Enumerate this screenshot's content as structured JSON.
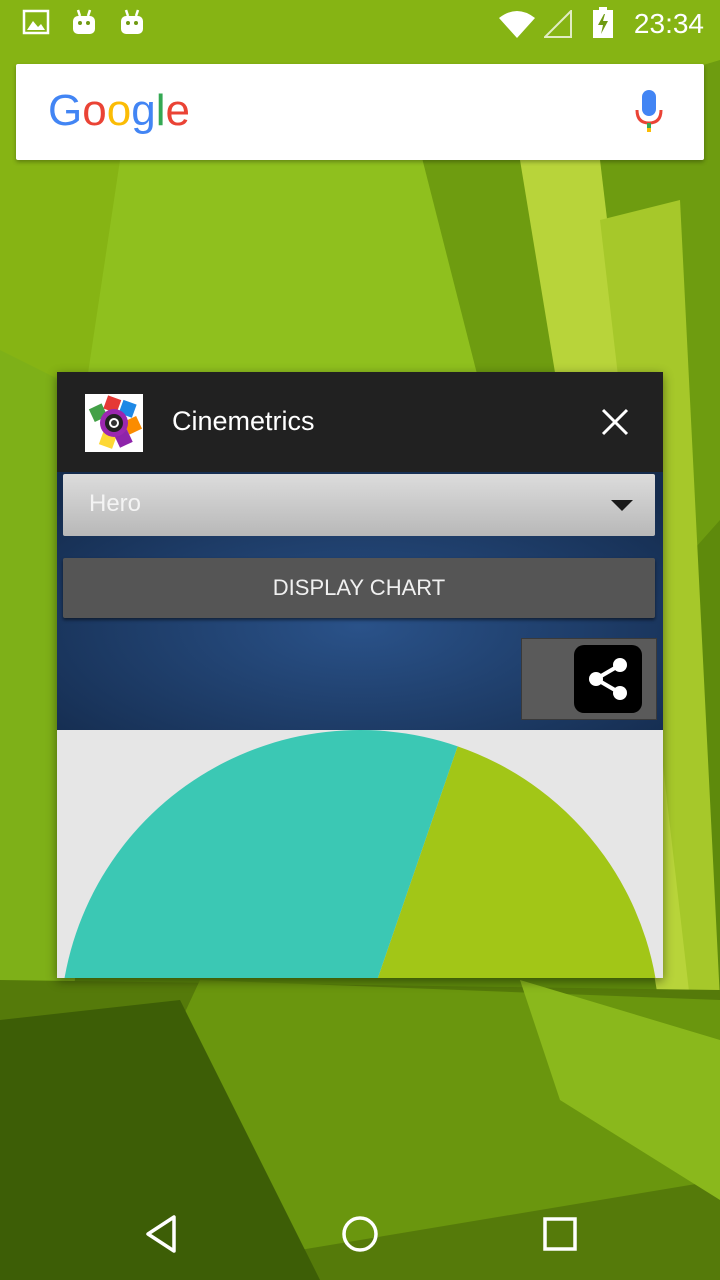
{
  "status_bar": {
    "time": "23:34",
    "icons": [
      "image-notification-icon",
      "android-notification-icon",
      "android-notification-icon",
      "wifi-icon",
      "signal-icon",
      "battery-charging-icon"
    ]
  },
  "search": {
    "logo_text": "Google",
    "logo_colors": [
      "#4285F4",
      "#EA4335",
      "#FBBC05",
      "#4285F4",
      "#34A853",
      "#EA4335"
    ],
    "mic_icon": "mic-icon"
  },
  "recent_card": {
    "title": "Cinemetrics",
    "close_icon": "close-icon",
    "app_icon": "cinemetrics-app-icon",
    "app": {
      "spinner_value": "Hero",
      "display_button": "DISPLAY CHART",
      "share_icon": "share-icon"
    }
  },
  "chart_data": {
    "type": "pie",
    "slice_colors": [
      "#3bc8b4",
      "#a2c617"
    ]
  },
  "nav_bar": {
    "items": [
      "back-icon",
      "home-icon",
      "recents-icon"
    ]
  }
}
